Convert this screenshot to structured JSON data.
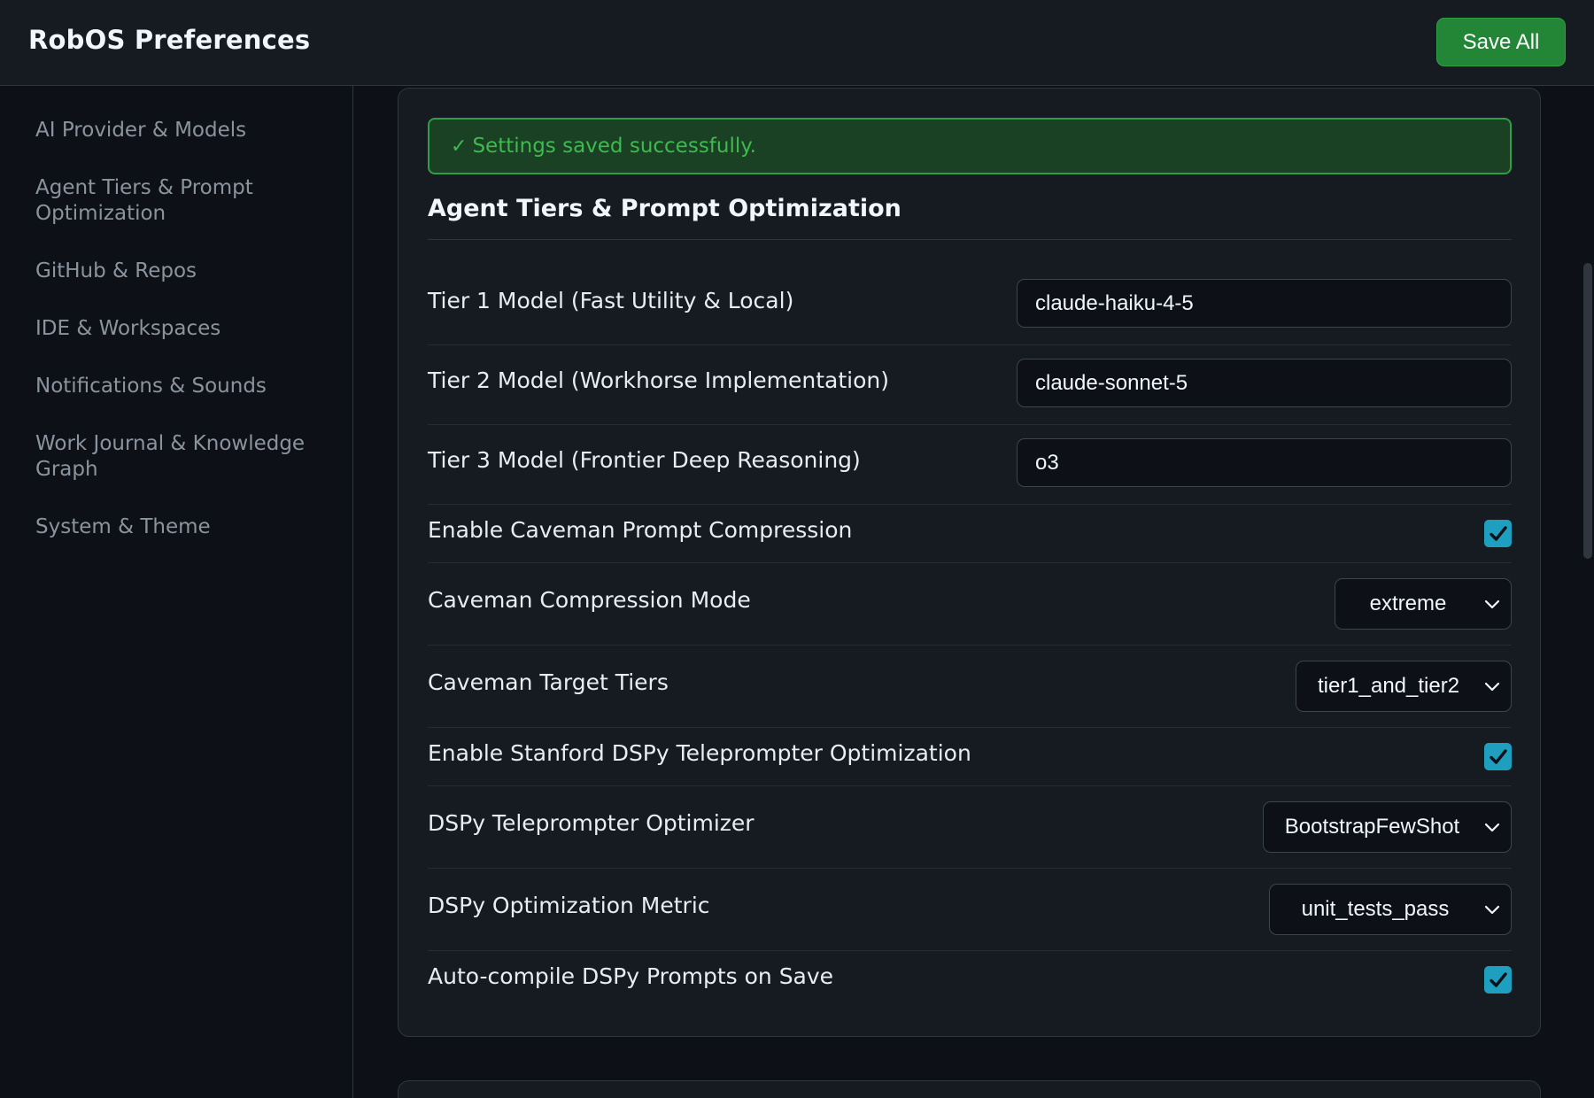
{
  "app": {
    "title": "RobOS Preferences",
    "save_all_label": "Save All"
  },
  "sidebar": {
    "items": [
      {
        "label": "AI Provider & Models"
      },
      {
        "label": "Agent Tiers & Prompt Optimization"
      },
      {
        "label": "GitHub & Repos"
      },
      {
        "label": "IDE & Workspaces"
      },
      {
        "label": "Notifications & Sounds"
      },
      {
        "label": "Work Journal & Knowledge Graph"
      },
      {
        "label": "System & Theme"
      }
    ]
  },
  "main": {
    "success_message": "Settings saved successfully.",
    "section_title": "Agent Tiers & Prompt Optimization",
    "fields": {
      "tier1": {
        "label": "Tier 1 Model (Fast Utility & Local)",
        "value": "claude-haiku-4-5"
      },
      "tier2": {
        "label": "Tier 2 Model (Workhorse Implementation)",
        "value": "claude-sonnet-5"
      },
      "tier3": {
        "label": "Tier 3 Model (Frontier Deep Reasoning)",
        "value": "o3"
      },
      "caveman_enable": {
        "label": "Enable Caveman Prompt Compression",
        "checked": true
      },
      "caveman_mode": {
        "label": "Caveman Compression Mode",
        "value": "extreme"
      },
      "caveman_tiers": {
        "label": "Caveman Target Tiers",
        "value": "tier1_and_tier2"
      },
      "dspy_enable": {
        "label": "Enable Stanford DSPy Teleprompter Optimization",
        "checked": true
      },
      "dspy_optimizer": {
        "label": "DSPy Teleprompter Optimizer",
        "value": "BootstrapFewShot"
      },
      "dspy_metric": {
        "label": "DSPy Optimization Metric",
        "value": "unit_tests_pass"
      },
      "dspy_autocompile": {
        "label": "Auto-compile DSPy Prompts on Save",
        "checked": true
      }
    }
  },
  "colors": {
    "accent_checkbox": "#1f9fbf",
    "success_green": "#3fb950",
    "save_button": "#238636"
  }
}
